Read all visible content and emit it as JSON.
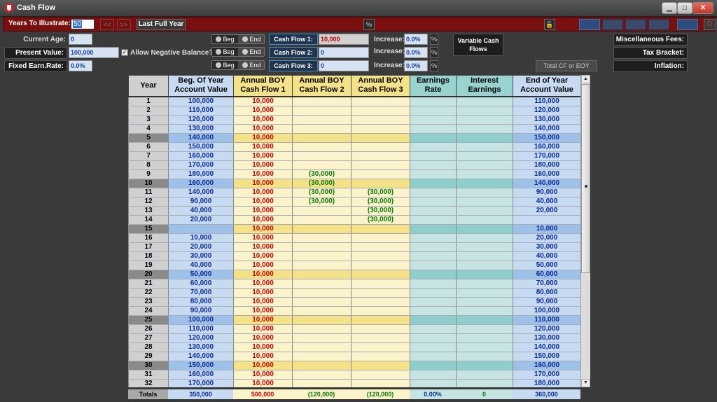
{
  "window": {
    "title": "Cash Flow",
    "minimize": "▁",
    "maximize": "□",
    "close": "✕"
  },
  "toolbar": {
    "years_label": "Years To Illustrate:",
    "years_value": "50",
    "prev_label": "<<",
    "next_label": ">>",
    "last_full_year_label": "Last Full Year",
    "percent_label": "%",
    "lock_icon": "lock-icon",
    "power_icon": "power-icon"
  },
  "inputs": {
    "current_age_label": "Current Age:",
    "current_age_value": "0",
    "present_value_label": "Present Value:",
    "present_value_value": "100,000",
    "allow_negative_label": "Allow Negative Balance?",
    "allow_negative_checked": "✓",
    "fixed_earn_label": "Fixed Earn.Rate:",
    "fixed_earn_value": "0.0%"
  },
  "cash_flows": [
    {
      "beg_label": "Beg",
      "end_label": "End",
      "button_label": "Cash Flow 1:",
      "value": "10,000",
      "increase_label": "Increase:",
      "increase_value": "0.0%",
      "pct_label": "%"
    },
    {
      "beg_label": "Beg",
      "end_label": "End",
      "button_label": "Cash Flow 2:",
      "value": "0",
      "increase_label": "Increase:",
      "increase_value": "0.0%",
      "pct_label": "%"
    },
    {
      "beg_label": "Beg",
      "end_label": "End",
      "button_label": "Cash Flow 3:",
      "value": "0",
      "increase_label": "Increase:",
      "increase_value": "0.0%",
      "pct_label": "%"
    }
  ],
  "variable_cash_flows_label": "Variable Cash Flows",
  "total_cf_label": "Total CF or EOY",
  "right_buttons": {
    "misc_fees": "Miscellaneous Fees:",
    "tax_bracket": "Tax Bracket:",
    "inflation": "Inflation:"
  },
  "columns": [
    "Year",
    "Beg. Of Year Account Value",
    "Annual BOY Cash Flow 1",
    "Annual BOY Cash Flow 2",
    "Annual BOY Cash Flow 3",
    "Earnings Rate",
    "Interest Earnings",
    "End of Year Account Value"
  ],
  "rows": [
    [
      "1",
      "100,000",
      "10,000",
      "",
      "",
      "",
      "",
      "110,000"
    ],
    [
      "2",
      "110,000",
      "10,000",
      "",
      "",
      "",
      "",
      "120,000"
    ],
    [
      "3",
      "120,000",
      "10,000",
      "",
      "",
      "",
      "",
      "130,000"
    ],
    [
      "4",
      "130,000",
      "10,000",
      "",
      "",
      "",
      "",
      "140,000"
    ],
    [
      "5",
      "140,000",
      "10,000",
      "",
      "",
      "",
      "",
      "150,000"
    ],
    [
      "6",
      "150,000",
      "10,000",
      "",
      "",
      "",
      "",
      "160,000"
    ],
    [
      "7",
      "160,000",
      "10,000",
      "",
      "",
      "",
      "",
      "170,000"
    ],
    [
      "8",
      "170,000",
      "10,000",
      "",
      "",
      "",
      "",
      "180,000"
    ],
    [
      "9",
      "180,000",
      "10,000",
      "(30,000)",
      "",
      "",
      "",
      "160,000"
    ],
    [
      "10",
      "160,000",
      "10,000",
      "(30,000)",
      "",
      "",
      "",
      "140,000"
    ],
    [
      "11",
      "140,000",
      "10,000",
      "(30,000)",
      "(30,000)",
      "",
      "",
      "90,000"
    ],
    [
      "12",
      "90,000",
      "10,000",
      "(30,000)",
      "(30,000)",
      "",
      "",
      "40,000"
    ],
    [
      "13",
      "40,000",
      "10,000",
      "",
      "(30,000)",
      "",
      "",
      "20,000"
    ],
    [
      "14",
      "20,000",
      "10,000",
      "",
      "(30,000)",
      "",
      "",
      ""
    ],
    [
      "15",
      "",
      "10,000",
      "",
      "",
      "",
      "",
      "10,000"
    ],
    [
      "16",
      "10,000",
      "10,000",
      "",
      "",
      "",
      "",
      "20,000"
    ],
    [
      "17",
      "20,000",
      "10,000",
      "",
      "",
      "",
      "",
      "30,000"
    ],
    [
      "18",
      "30,000",
      "10,000",
      "",
      "",
      "",
      "",
      "40,000"
    ],
    [
      "19",
      "40,000",
      "10,000",
      "",
      "",
      "",
      "",
      "50,000"
    ],
    [
      "20",
      "50,000",
      "10,000",
      "",
      "",
      "",
      "",
      "60,000"
    ],
    [
      "21",
      "60,000",
      "10,000",
      "",
      "",
      "",
      "",
      "70,000"
    ],
    [
      "22",
      "70,000",
      "10,000",
      "",
      "",
      "",
      "",
      "80,000"
    ],
    [
      "23",
      "80,000",
      "10,000",
      "",
      "",
      "",
      "",
      "90,000"
    ],
    [
      "24",
      "90,000",
      "10,000",
      "",
      "",
      "",
      "",
      "100,000"
    ],
    [
      "25",
      "100,000",
      "10,000",
      "",
      "",
      "",
      "",
      "110,000"
    ],
    [
      "26",
      "110,000",
      "10,000",
      "",
      "",
      "",
      "",
      "120,000"
    ],
    [
      "27",
      "120,000",
      "10,000",
      "",
      "",
      "",
      "",
      "130,000"
    ],
    [
      "28",
      "130,000",
      "10,000",
      "",
      "",
      "",
      "",
      "140,000"
    ],
    [
      "29",
      "140,000",
      "10,000",
      "",
      "",
      "",
      "",
      "150,000"
    ],
    [
      "30",
      "150,000",
      "10,000",
      "",
      "",
      "",
      "",
      "160,000"
    ],
    [
      "31",
      "160,000",
      "10,000",
      "",
      "",
      "",
      "",
      "170,000"
    ],
    [
      "32",
      "170,000",
      "10,000",
      "",
      "",
      "",
      "",
      "180,000"
    ]
  ],
  "highlight_years": [
    "5",
    "10",
    "15",
    "20",
    "25",
    "30"
  ],
  "totals": {
    "label": "Totals",
    "beg": "350,000",
    "cf1": "500,000",
    "cf2": "(120,000)",
    "cf3": "(120,000)",
    "earn": "0.00%",
    "int": "0",
    "end": "360,000"
  },
  "scrollbar": {
    "up": "▲",
    "down": "▼"
  }
}
